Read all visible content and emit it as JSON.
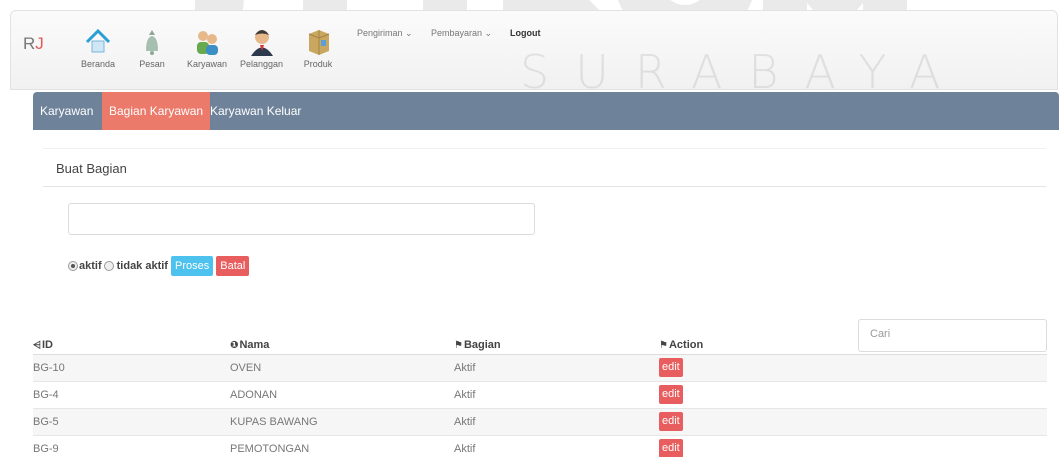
{
  "watermark": {
    "big": "STIKOM",
    "small": "SURABAYA"
  },
  "brand": "RJ",
  "nav": {
    "items": [
      {
        "label": "Beranda",
        "icon": "home-icon"
      },
      {
        "label": "Pesan",
        "icon": "bell-icon"
      },
      {
        "label": "Karyawan",
        "icon": "users-icon"
      },
      {
        "label": "Pelanggan",
        "icon": "customer-icon"
      },
      {
        "label": "Produk",
        "icon": "box-icon"
      }
    ],
    "pengiriman": "Pengiriman ⌄",
    "pembayaran": "Pembayaran ⌄",
    "logout": "Logout"
  },
  "tabs": [
    {
      "label": "Karyawan",
      "active": false
    },
    {
      "label": "Bagian Karyawan",
      "active": true
    },
    {
      "label": "Karyawan Keluar",
      "active": false
    }
  ],
  "form": {
    "title": "Buat Bagian",
    "input_value": "",
    "radio_aktif": "aktif",
    "radio_tidak_aktif": "tidak aktif",
    "proses": "Proses",
    "batal": "Batal"
  },
  "search": {
    "placeholder": "Cari"
  },
  "table": {
    "headers": {
      "id": "ID",
      "nama": "Nama",
      "bagian": "Bagian",
      "action": "Action"
    },
    "rows": [
      {
        "id": "BG-10",
        "nama": "OVEN",
        "bagian": "Aktif",
        "action": "edit"
      },
      {
        "id": "BG-4",
        "nama": "ADONAN",
        "bagian": "Aktif",
        "action": "edit"
      },
      {
        "id": "BG-5",
        "nama": "KUPAS BAWANG",
        "bagian": "Aktif",
        "action": "edit"
      },
      {
        "id": "BG-9",
        "nama": "PEMOTONGAN",
        "bagian": "Aktif",
        "action": "edit"
      }
    ]
  },
  "colors": {
    "accent": "#ec7a6b",
    "tabbar": "#6e829a",
    "btn_blue": "#4dc2ef",
    "btn_red": "#e85d5d"
  }
}
